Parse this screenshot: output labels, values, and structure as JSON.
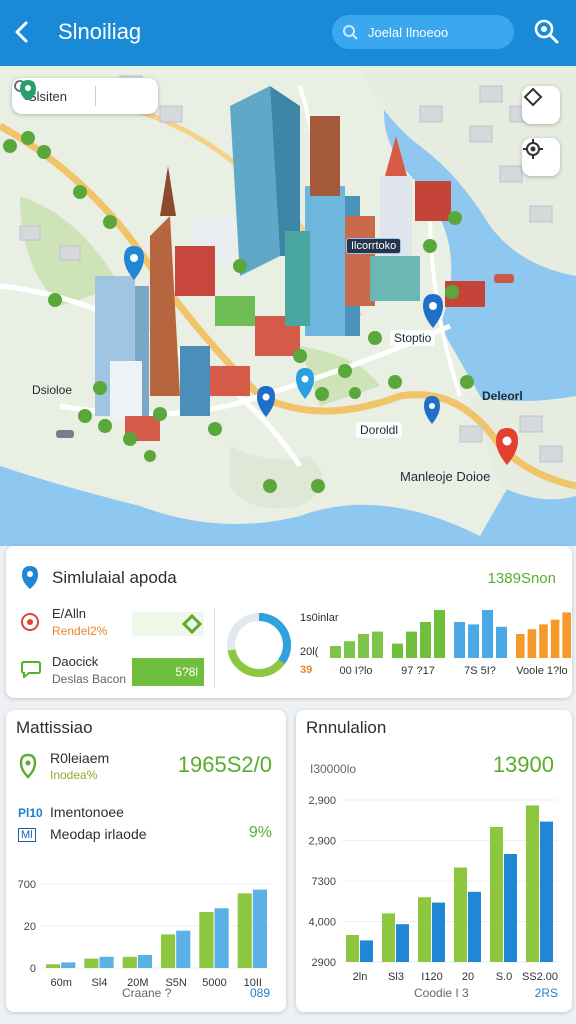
{
  "header": {
    "title": "Slnoiliag",
    "search_text": "Joelal Ilnoeoo",
    "bg_color": "#1a8ad8"
  },
  "map": {
    "search_text": "Slsiten",
    "labels": {
      "building_tag": "Ilcorrtoko",
      "station": "Stoptio",
      "bay": "Doroldl",
      "coast": "Dsioloe",
      "east": "Deleorl",
      "market": "Manleoje Doioe"
    }
  },
  "summary": {
    "title": "Simlulaial apoda",
    "value": "1389Snon",
    "row1_label": "E/Alln",
    "row1_sub": "Rendel2%",
    "row2_label": "Daocick",
    "row2_sub": "Deslas Bacon",
    "row2_bar_value": "5?8l",
    "donut_title": "1s0inlar",
    "donut_value1": "20l(",
    "donut_value2": "39",
    "donut_fraction": 0.72,
    "tick_labels": [
      "00 I?lo",
      "97 ?17",
      "7S 5I?",
      "Voole 1?lo"
    ],
    "mini_charts": [
      {
        "values": [
          0.25,
          0.35,
          0.5,
          0.55
        ],
        "color": "#7cc34a"
      },
      {
        "values": [
          0.3,
          0.55,
          0.75,
          1.0
        ],
        "color": "#6fbf3c"
      },
      {
        "values": [
          0.75,
          0.7,
          1.0,
          0.65
        ],
        "color": "#4aa9e6"
      },
      {
        "values": [
          0.5,
          0.6,
          0.7,
          0.8,
          0.95
        ],
        "color": "#f39a2a"
      }
    ]
  },
  "left_panel": {
    "title": "Mattissiao",
    "item1_label": "R0leiaem",
    "item1_sub": "Inodea%",
    "item1_value": "1965S2/0",
    "item2_code": "Pl10",
    "item2_label": "Imentonoee",
    "item2_code2": "Ml",
    "item2_label2": "Meodap irlaode",
    "item2_value": "9%",
    "y_ticks": [
      "700",
      "20",
      "0"
    ],
    "x_ticks": [
      "60m",
      "Sl4",
      "20M",
      "S5N",
      "5000",
      "10II"
    ],
    "footer_left": "Craane ?",
    "footer_right": "089",
    "chart_data": {
      "type": "bar",
      "categories": [
        "60m",
        "Sl4",
        "20M",
        "S5N",
        "5000",
        "10II"
      ],
      "series": [
        {
          "values": [
            2,
            5,
            6,
            18,
            30,
            40
          ],
          "color": "#8dc63f"
        },
        {
          "values": [
            3,
            6,
            7,
            20,
            32,
            42
          ],
          "color": "#5bb1e6"
        }
      ],
      "ylim": [
        0,
        45
      ]
    }
  },
  "right_panel": {
    "title": "Rnnulalion",
    "value": "13900",
    "subtitle": "I30000lo",
    "y_ticks": [
      "2,900",
      "2,900",
      "7300",
      "4,000",
      "2900"
    ],
    "x_ticks": [
      "2ln",
      "Sl3",
      "I120",
      "20",
      "S.0",
      "SS2.00"
    ],
    "footer_left": "Coodie I 3",
    "footer_right": "2RS",
    "chart_data": {
      "type": "bar",
      "categories": [
        "2ln",
        "Sl3",
        "I120",
        "20",
        "S.0",
        "SS2.00"
      ],
      "series": [
        {
          "values": [
            10,
            18,
            24,
            35,
            50,
            58
          ],
          "color": "#8dc63f"
        },
        {
          "values": [
            8,
            14,
            22,
            26,
            40,
            52
          ],
          "color": "#1f87d6"
        }
      ],
      "ylim": [
        0,
        60
      ]
    }
  }
}
